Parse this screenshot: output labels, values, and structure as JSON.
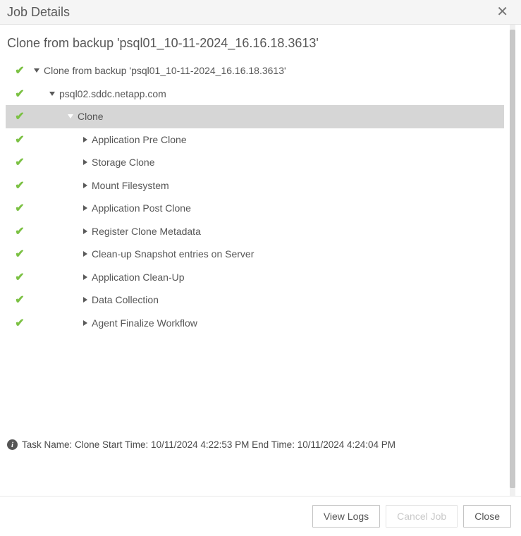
{
  "title": "Job Details",
  "subtitle": "Clone from backup 'psql01_10-11-2024_16.16.18.3613'",
  "tree": [
    {
      "status": "ok",
      "indent": 0,
      "caret": "down",
      "label": "Clone from backup 'psql01_10-11-2024_16.16.18.3613'",
      "selected": false
    },
    {
      "status": "ok",
      "indent": 1,
      "caret": "down",
      "label": "psql02.sddc.netapp.com",
      "selected": false
    },
    {
      "status": "ok",
      "indent": 2,
      "caret": "down-light",
      "label": "Clone",
      "selected": true
    },
    {
      "status": "ok",
      "indent": 3,
      "caret": "right",
      "label": "Application Pre Clone",
      "selected": false
    },
    {
      "status": "ok",
      "indent": 3,
      "caret": "right",
      "label": "Storage Clone",
      "selected": false
    },
    {
      "status": "ok",
      "indent": 3,
      "caret": "right",
      "label": "Mount Filesystem",
      "selected": false
    },
    {
      "status": "ok",
      "indent": 3,
      "caret": "right",
      "label": "Application Post Clone",
      "selected": false
    },
    {
      "status": "ok",
      "indent": 3,
      "caret": "right",
      "label": "Register Clone Metadata",
      "selected": false
    },
    {
      "status": "ok",
      "indent": 3,
      "caret": "right",
      "label": "Clean-up Snapshot entries on Server",
      "selected": false
    },
    {
      "status": "ok",
      "indent": 3,
      "caret": "right",
      "label": "Application Clean-Up",
      "selected": false
    },
    {
      "status": "ok",
      "indent": 3,
      "caret": "right",
      "label": "Data Collection",
      "selected": false
    },
    {
      "status": "ok",
      "indent": 3,
      "caret": "right",
      "label": "Agent Finalize Workflow",
      "selected": false
    }
  ],
  "footer": {
    "text": "Task Name: Clone Start Time: 10/11/2024 4:22:53 PM End Time: 10/11/2024 4:24:04 PM"
  },
  "buttons": {
    "view_logs": "View Logs",
    "cancel_job": "Cancel Job",
    "close": "Close"
  }
}
